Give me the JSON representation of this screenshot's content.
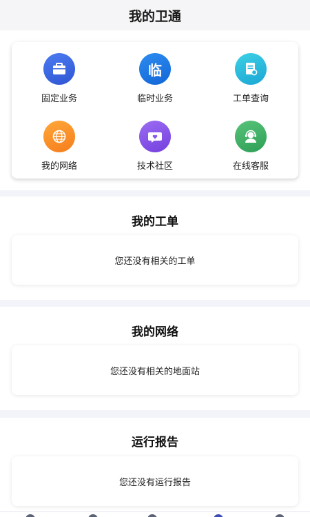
{
  "header": {
    "title": "我的卫通"
  },
  "services": [
    {
      "label": "固定业务",
      "icon": "briefcase-icon",
      "color_from": "#4b7cf0",
      "color_to": "#2f55d4"
    },
    {
      "label": "临时业务",
      "icon": "temporary-icon",
      "glyph": "临",
      "color_from": "#2d8cf0",
      "color_to": "#1266d6"
    },
    {
      "label": "工单查询",
      "icon": "document-search-icon",
      "color_from": "#3ed0e6",
      "color_to": "#1aa6d4"
    },
    {
      "label": "我的网络",
      "icon": "globe-icon",
      "color_from": "#ffa83a",
      "color_to": "#f57c1c"
    },
    {
      "label": "技术社区",
      "icon": "chat-heart-icon",
      "color_from": "#9b6cf2",
      "color_to": "#7440de"
    },
    {
      "label": "在线客服",
      "icon": "headset-agent-icon",
      "color_from": "#58c47a",
      "color_to": "#2e9e56"
    }
  ],
  "sections": [
    {
      "title": "我的工单",
      "empty_text": "您还没有相关的工单"
    },
    {
      "title": "我的网络",
      "empty_text": "您还没有相关的地面站"
    },
    {
      "title": "运行报告",
      "empty_text": "您还没有运行报告"
    }
  ]
}
